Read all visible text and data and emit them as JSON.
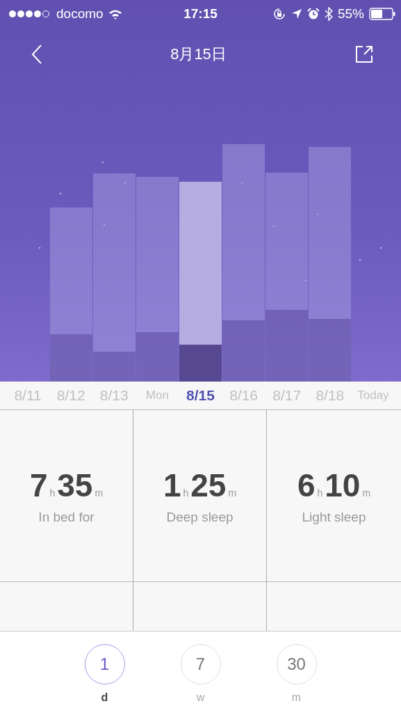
{
  "status_bar": {
    "carrier": "docomo",
    "time": "17:15",
    "battery": "55%"
  },
  "nav": {
    "title": "8月15日"
  },
  "dates": [
    {
      "label": "8/11",
      "kind": "date",
      "selected": false
    },
    {
      "label": "8/12",
      "kind": "date",
      "selected": false
    },
    {
      "label": "8/13",
      "kind": "date",
      "selected": false
    },
    {
      "label": "Mon",
      "kind": "word",
      "selected": false
    },
    {
      "label": "8/15",
      "kind": "date",
      "selected": true
    },
    {
      "label": "8/16",
      "kind": "date",
      "selected": false
    },
    {
      "label": "8/17",
      "kind": "date",
      "selected": false
    },
    {
      "label": "8/18",
      "kind": "date",
      "selected": false
    },
    {
      "label": "Today",
      "kind": "word",
      "selected": false
    }
  ],
  "stats": [
    {
      "hours": "7",
      "hour_unit": "h",
      "minutes": "35",
      "minute_unit": "m",
      "label": "In bed for"
    },
    {
      "hours": "1",
      "hour_unit": "h",
      "minutes": "25",
      "minute_unit": "m",
      "label": "Deep sleep"
    },
    {
      "hours": "6",
      "hour_unit": "h",
      "minutes": "10",
      "minute_unit": "m",
      "label": "Light sleep"
    }
  ],
  "ranges": [
    {
      "value": "1",
      "unit": "d",
      "selected": true
    },
    {
      "value": "7",
      "unit": "w",
      "selected": false
    },
    {
      "value": "30",
      "unit": "m",
      "selected": false
    }
  ]
}
